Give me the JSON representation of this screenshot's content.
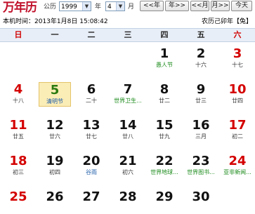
{
  "logo": "万年历",
  "controls": {
    "calendar_type": "公历",
    "year": "1999",
    "year_suffix": "年",
    "month": "4",
    "month_suffix": "月",
    "prev_year": "<<年",
    "next_year": "年>>",
    "prev_month": "<<月",
    "next_month": "月>>",
    "today": "今天"
  },
  "info": {
    "local_time": "本机时间：2013年1月8日 15:08:42",
    "lunar_year": "农历己卯年【兔】"
  },
  "weekdays": [
    "日",
    "一",
    "二",
    "三",
    "四",
    "五",
    "六"
  ],
  "weeks": [
    [
      null,
      null,
      null,
      null,
      {
        "day": "1",
        "sub": "愚人节",
        "subtype": "green"
      },
      {
        "day": "2",
        "sub": "十六"
      },
      {
        "day": "3",
        "sub": "十七",
        "red": true
      }
    ],
    [
      {
        "day": "4",
        "sub": "十八",
        "red": true
      },
      {
        "day": "5",
        "sub": "清明节",
        "subtype": "blue",
        "today": true
      },
      {
        "day": "6",
        "sub": "二十"
      },
      {
        "day": "7",
        "sub": "世界卫生...",
        "subtype": "green"
      },
      {
        "day": "8",
        "sub": "廿二"
      },
      {
        "day": "9",
        "sub": "廿三"
      },
      {
        "day": "10",
        "sub": "廿四",
        "red": true
      }
    ],
    [
      {
        "day": "11",
        "sub": "廿五",
        "red": true
      },
      {
        "day": "12",
        "sub": "廿六"
      },
      {
        "day": "13",
        "sub": "廿七"
      },
      {
        "day": "14",
        "sub": "廿八"
      },
      {
        "day": "15",
        "sub": "廿九"
      },
      {
        "day": "16",
        "sub": "三月"
      },
      {
        "day": "17",
        "sub": "初二",
        "red": true
      }
    ],
    [
      {
        "day": "18",
        "sub": "初三",
        "red": true
      },
      {
        "day": "19",
        "sub": "初四"
      },
      {
        "day": "20",
        "sub": "谷雨",
        "subtype": "blue"
      },
      {
        "day": "21",
        "sub": "初六"
      },
      {
        "day": "22",
        "sub": "世界地球...",
        "subtype": "green"
      },
      {
        "day": "23",
        "sub": "世界图书...",
        "subtype": "green"
      },
      {
        "day": "24",
        "sub": "亚非新闻...",
        "subtype": "green",
        "red": true
      }
    ],
    [
      {
        "day": "25",
        "sub": "",
        "red": true
      },
      {
        "day": "26",
        "sub": ""
      },
      {
        "day": "27",
        "sub": ""
      },
      {
        "day": "28",
        "sub": ""
      },
      {
        "day": "29",
        "sub": ""
      },
      {
        "day": "30",
        "sub": ""
      },
      null
    ]
  ]
}
